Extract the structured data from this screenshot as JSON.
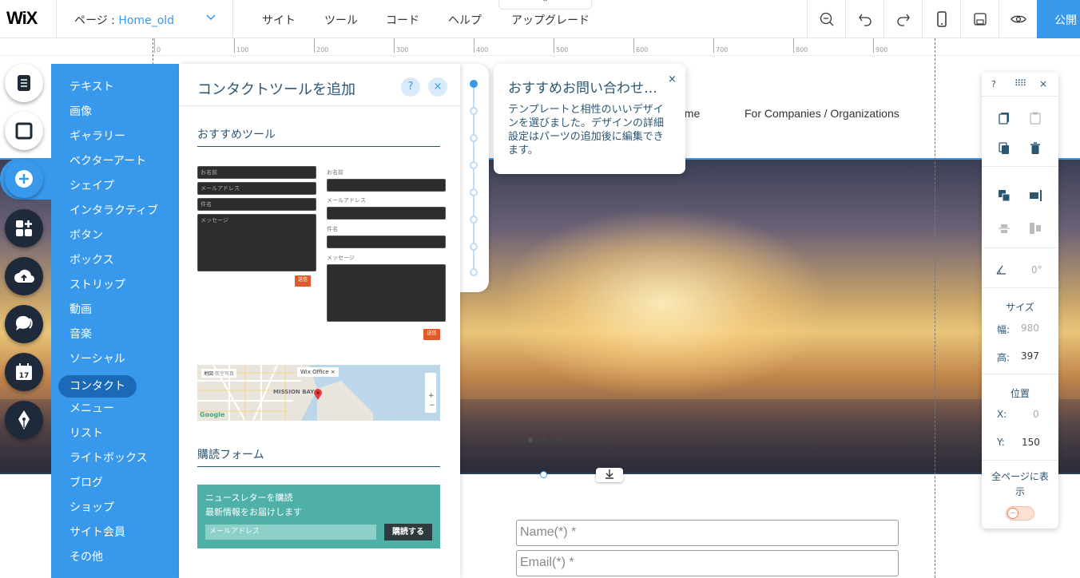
{
  "topbar": {
    "logo": "WiX",
    "page_label": "ページ : ",
    "page_value": "Home_old",
    "menu": [
      "サイト",
      "ツール",
      "コード",
      "ヘルプ",
      "アップグレード"
    ],
    "icons": [
      "zoom-out-icon",
      "undo-icon",
      "redo-icon",
      "mobile-icon",
      "save-icon",
      "preview-icon"
    ],
    "publish": "公開"
  },
  "ruler": {
    "ticks": [
      "0",
      "100",
      "200",
      "300",
      "400",
      "500",
      "600",
      "700",
      "800",
      "900"
    ]
  },
  "site": {
    "nav": [
      "sume",
      "For Companies / Organizations"
    ],
    "form_placeholders": [
      "Name(*) *",
      "Email(*) *"
    ]
  },
  "categories": {
    "items": [
      "テキスト",
      "画像",
      "ギャラリー",
      "ベクターアート",
      "シェイプ",
      "インタラクティブ",
      "ボタン",
      "ボックス",
      "ストリップ",
      "動画",
      "音楽",
      "ソーシャル",
      "コンタクト",
      "メニュー",
      "リスト",
      "ライトボックス",
      "ブログ",
      "ショップ",
      "サイト会員",
      "その他"
    ],
    "selected_index": 12
  },
  "tool_panel": {
    "title": "コンタクトツールを追加",
    "help": "?",
    "close": "×",
    "section1": "おすすめツール",
    "form1": {
      "fields": [
        "お名前",
        "メールアドレス",
        "件名",
        "メッセージ"
      ],
      "send": "送信"
    },
    "form2": {
      "labels": [
        "お名前",
        "メールアドレス",
        "件名",
        "メッセージ"
      ],
      "send": "送信"
    },
    "map": {
      "tab1": "地図",
      "tab2": "航空写真",
      "pin_label": "Wix Office",
      "area": "MISSION BAY",
      "brand": "Google"
    },
    "section2": "購読フォーム",
    "newsletter": {
      "line1": "ニュースレターを購読",
      "line2": "最新情報をお届けします",
      "placeholder": "メールアドレス",
      "button": "購読する"
    }
  },
  "tooltip": {
    "title": "おすすめお問い合わせ…",
    "body": "テンプレートと相性のいいデザインを選びました。デザインの詳細設定はパーツの追加後に編集できます。",
    "close": "×"
  },
  "right_panel": {
    "help": "?",
    "close": "×",
    "rotation": "0°",
    "size_label": "サイズ",
    "width_label": "幅:",
    "width_value": "980",
    "height_label": "高:",
    "height_value": "397",
    "position_label": "位置",
    "x_label": "X:",
    "x_value": "0",
    "y_label": "Y:",
    "y_value": "150",
    "show_all_label": "全ページに表示",
    "show_all_on": false
  },
  "colors": {
    "accent": "#3899ec",
    "panel_text": "#2b5672",
    "send": "#e05a2b",
    "newsletter": "#4fb0a8"
  }
}
